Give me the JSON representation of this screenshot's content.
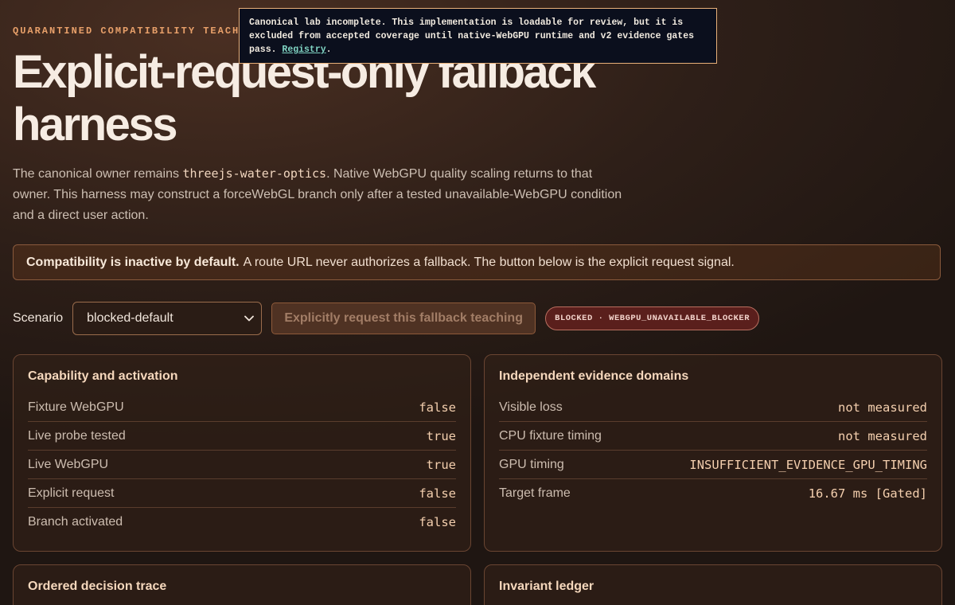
{
  "header": {
    "eyebrow": "QUARANTINED COMPATIBILITY TEACHING",
    "title": "Explicit-request-only fallback harness",
    "intro_before": "The canonical owner remains ",
    "intro_code": "threejs-water-optics",
    "intro_after": ". Native WebGPU quality scaling returns to that owner. This harness may construct a forceWebGL branch only after a tested unavailable-WebGPU condition and a direct user action."
  },
  "notice": {
    "text": "Canonical lab incomplete. This implementation is loadable for review, but it is excluded from accepted coverage until native-WebGPU runtime and v2 evidence gates pass. ",
    "link_label": "Registry",
    "trailing": "."
  },
  "banner": {
    "strong": "Compatibility is inactive by default.",
    "text": "A route URL never authorizes a fallback. The button below is the explicit request signal."
  },
  "controls": {
    "scenario_label": "Scenario",
    "scenario_value": "blocked-default",
    "request_button": "Explicitly request this fallback teaching",
    "status_badge": "BLOCKED · WEBGPU_UNAVAILABLE_BLOCKER"
  },
  "cards": {
    "capability": {
      "title": "Capability and activation",
      "rows": [
        {
          "label": "Fixture WebGPU",
          "value": "false"
        },
        {
          "label": "Live probe tested",
          "value": "true"
        },
        {
          "label": "Live WebGPU",
          "value": "true"
        },
        {
          "label": "Explicit request",
          "value": "false"
        },
        {
          "label": "Branch activated",
          "value": "false"
        }
      ]
    },
    "evidence": {
      "title": "Independent evidence domains",
      "rows": [
        {
          "label": "Visible loss",
          "value": "not measured"
        },
        {
          "label": "CPU fixture timing",
          "value": "not measured"
        },
        {
          "label": "GPU timing",
          "value": "INSUFFICIENT_EVIDENCE_GPU_TIMING"
        },
        {
          "label": "Target frame",
          "value": "16.67 ms [Gated]"
        }
      ]
    },
    "trace": {
      "title": "Ordered decision trace"
    },
    "ledger": {
      "title": "Invariant ledger"
    }
  },
  "icons": {
    "select_chevron": "chevron-down-icon"
  },
  "colors": {
    "accent": "#e8a06a",
    "value_text": "#f4cfae",
    "blocked_badge": "#5a1f1c",
    "notice_link": "#7fd3c2"
  }
}
